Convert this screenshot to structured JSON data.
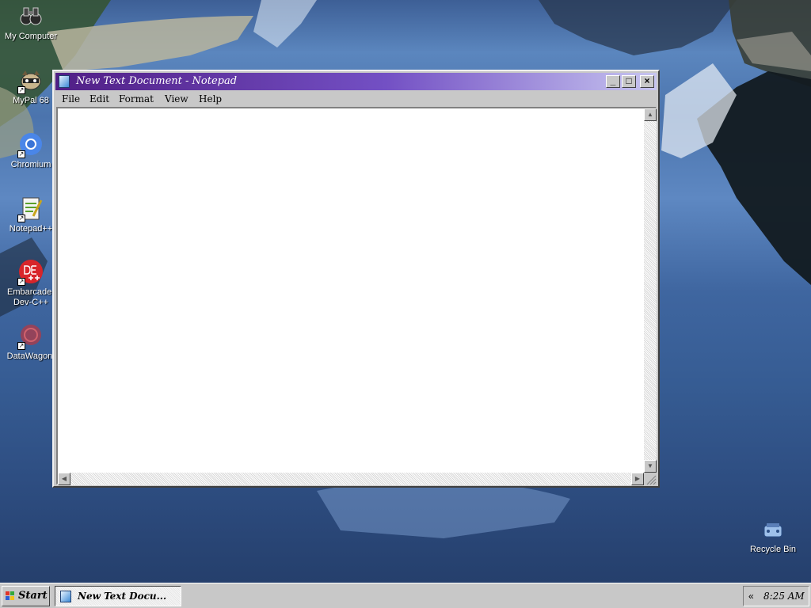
{
  "desktop": {
    "icons": [
      {
        "label": "My Computer"
      },
      {
        "label": "MyPal 68"
      },
      {
        "label": "Chromium"
      },
      {
        "label": "Notepad++"
      },
      {
        "label_line1": "Embarcader",
        "label_line2": "Dev-C++"
      },
      {
        "label": "DataWagon."
      },
      {
        "label": "Recycle Bin"
      }
    ]
  },
  "window": {
    "title": "New Text Document - Notepad",
    "controls": {
      "minimize": "_",
      "maximize": "□",
      "close": "×"
    },
    "menu": [
      "File",
      "Edit",
      "Format",
      "View",
      "Help"
    ],
    "content": ""
  },
  "taskbar": {
    "start_label": "Start",
    "task_label": "New Text Docu...",
    "tray_arrow": "«",
    "clock": "8:25 AM"
  },
  "colors": {
    "titlebar_start": "#511f86",
    "titlebar_end": "#c7c5f0",
    "chrome": "#c8c8c8"
  },
  "icon_names": [
    "binoculars-icon",
    "raccoon-icon",
    "chromium-icon",
    "notepadpp-icon",
    "devcpp-icon",
    "datawagon-icon",
    "recycle-bin-icon"
  ]
}
